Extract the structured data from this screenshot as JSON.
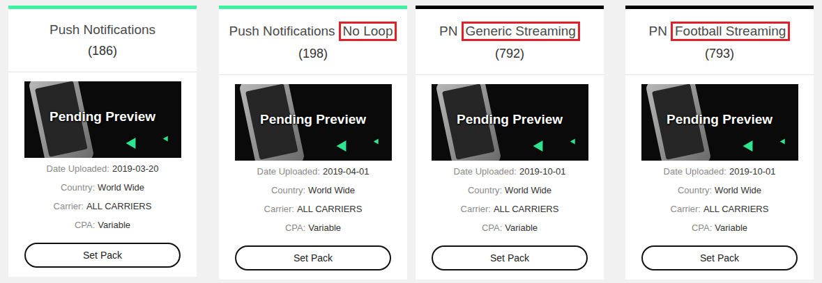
{
  "cards": [
    {
      "title_parts": [
        {
          "text": "Push Notifications",
          "highlighted": false
        }
      ],
      "count": "(186)",
      "color": "#3ef0a2",
      "preview": "Pending Preview",
      "fields": [
        {
          "label": "Date Uploaded:",
          "value": "2019-03-20"
        },
        {
          "label": "Country:",
          "value": "World Wide"
        },
        {
          "label": "Carrier:",
          "value": "ALL CARRIERS"
        },
        {
          "label": "CPA:",
          "value": "Variable"
        }
      ],
      "button": "Set Pack"
    },
    {
      "title_parts": [
        {
          "text": "Push Notifications",
          "highlighted": false
        },
        {
          "text": "No Loop",
          "highlighted": true
        }
      ],
      "count": "(198)",
      "color": "#3ef0a2",
      "preview": "Pending Preview",
      "fields": [
        {
          "label": "Date Uploaded:",
          "value": "2019-04-01"
        },
        {
          "label": "Country:",
          "value": "World Wide"
        },
        {
          "label": "Carrier:",
          "value": "ALL CARRIERS"
        },
        {
          "label": "CPA:",
          "value": "Variable"
        }
      ],
      "button": "Set Pack"
    },
    {
      "title_parts": [
        {
          "text": "PN",
          "highlighted": false
        },
        {
          "text": "Generic Streaming",
          "highlighted": true
        }
      ],
      "count": "(792)",
      "color": "#000000",
      "preview": "Pending Preview",
      "fields": [
        {
          "label": "Date Uploaded:",
          "value": "2019-10-01"
        },
        {
          "label": "Country:",
          "value": "World Wide"
        },
        {
          "label": "Carrier:",
          "value": "ALL CARRIERS"
        },
        {
          "label": "CPA:",
          "value": "Variable"
        }
      ],
      "button": "Set Pack"
    },
    {
      "title_parts": [
        {
          "text": "PN",
          "highlighted": false
        },
        {
          "text": "Football Streaming",
          "highlighted": true
        }
      ],
      "count": "(793)",
      "color": "#000000",
      "preview": "Pending Preview",
      "fields": [
        {
          "label": "Date Uploaded:",
          "value": "2019-10-01"
        },
        {
          "label": "Country:",
          "value": "World Wide"
        },
        {
          "label": "Carrier:",
          "value": "ALL CARRIERS"
        },
        {
          "label": "CPA:",
          "value": "Variable"
        }
      ],
      "button": "Set Pack"
    }
  ]
}
